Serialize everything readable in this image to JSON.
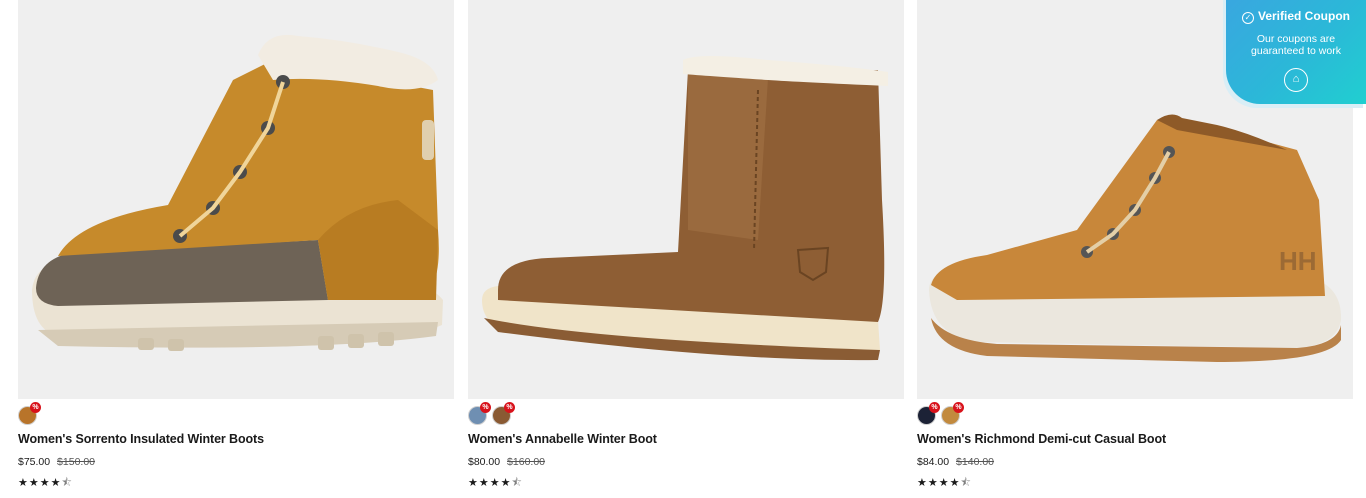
{
  "products": [
    {
      "name": "Women's Sorrento Insulated Winter Boots",
      "price": "$75.00",
      "original_price": "$150.00",
      "stars": "★★★★",
      "half_star": "⯪",
      "swatches": [
        {
          "color": "#b8742a",
          "sale_badge": "%"
        }
      ]
    },
    {
      "name": "Women's Annabelle Winter Boot",
      "price": "$80.00",
      "original_price": "$160.00",
      "stars": "★★★★",
      "half_star": "⯪",
      "swatches": [
        {
          "color": "#6f8fb2",
          "sale_badge": "%"
        },
        {
          "color": "#8a5a33",
          "sale_badge": "%"
        }
      ]
    },
    {
      "name": "Women's Richmond Demi-cut Casual Boot",
      "price": "$84.00",
      "original_price": "$140.00",
      "stars": "★★★★",
      "half_star": "⯪",
      "swatches": [
        {
          "color": "#1c2236",
          "sale_badge": "%"
        },
        {
          "color": "#c28a3e",
          "sale_badge": "%"
        }
      ]
    }
  ],
  "coupon": {
    "title": "Verified Coupon",
    "subtitle": "Our coupons are guaranteed to work",
    "check_glyph": "✓",
    "icon_glyph": "⌂"
  },
  "icons": {
    "coupon_check": "check-circle-icon",
    "coupon_tag": "tag-icon",
    "rating": "star-icon"
  }
}
